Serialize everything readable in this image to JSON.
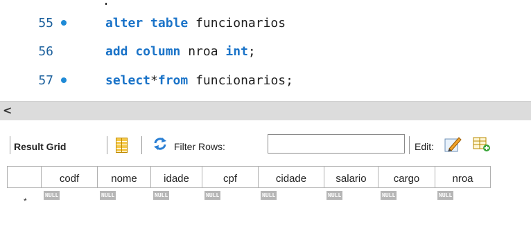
{
  "editor": {
    "lines": [
      {
        "number": "55",
        "breakpoint": true,
        "tokens": [
          {
            "t": "alter table",
            "kw": true
          },
          {
            "t": " funcionarios",
            "kw": false
          }
        ]
      },
      {
        "number": "56",
        "breakpoint": false,
        "tokens": [
          {
            "t": "add column",
            "kw": true
          },
          {
            "t": " nroa ",
            "kw": false
          },
          {
            "t": "int",
            "kw": true
          },
          {
            "t": ";",
            "kw": false
          }
        ]
      },
      {
        "number": "57",
        "breakpoint": true,
        "tokens": [
          {
            "t": "select",
            "kw": true
          },
          {
            "t": "*",
            "kw": false
          },
          {
            "t": "from",
            "kw": true
          },
          {
            "t": " funcionarios;",
            "kw": false
          }
        ]
      }
    ],
    "keyword_color": "#1a73c8",
    "line_number_color": "#1a5f9c"
  },
  "scrollbar": {
    "left_arrow": "<"
  },
  "toolbar": {
    "result_grid_label": "Result Grid",
    "filter_label": "Filter Rows:",
    "filter_value": "",
    "edit_label": "Edit:",
    "icons": [
      "grid-layout-icon",
      "refresh-icon",
      "edit-pencil-icon",
      "add-row-icon"
    ]
  },
  "grid": {
    "columns": [
      "codf",
      "nome",
      "idade",
      "cpf",
      "cidade",
      "salario",
      "cargo",
      "nroa"
    ],
    "rows": [
      {
        "marker": "*",
        "cells": [
          "NULL",
          "NULL",
          "NULL",
          "NULL",
          "NULL",
          "NULL",
          "NULL",
          "NULL"
        ]
      }
    ]
  }
}
